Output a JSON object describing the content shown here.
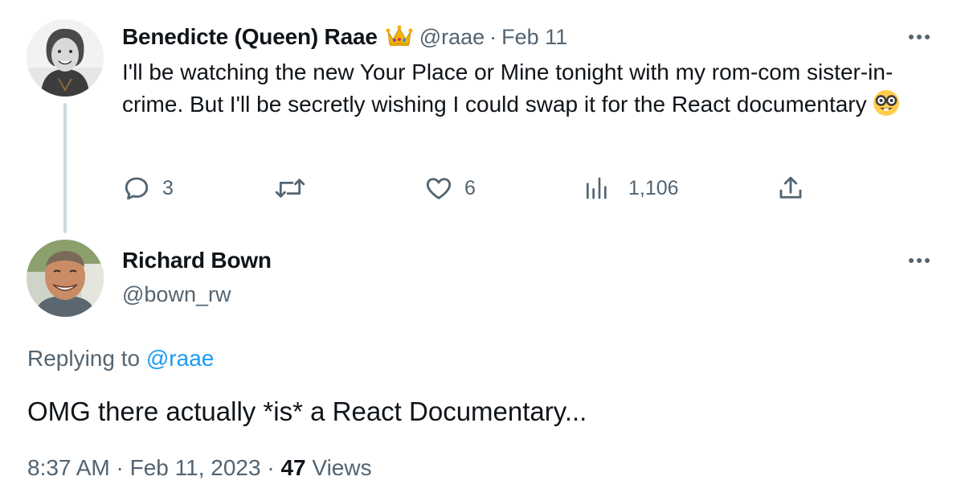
{
  "tweet1": {
    "author_name": "Benedicte (Queen) Raae",
    "author_badge": "crown-emoji",
    "handle": "@raae",
    "separator": "·",
    "date": "Feb 11",
    "text": "I'll be watching the new Your Place or Mine tonight with my rom-com sister-in-crime. But I'll be secretly wishing I could swap it for the React documentary",
    "text_emoji": "nerd-face-emoji",
    "actions": {
      "replies": "3",
      "retweets": "",
      "likes": "6",
      "views": "1,106"
    }
  },
  "tweet2": {
    "author_name": "Richard Bown",
    "handle": "@bown_rw",
    "replying_prefix": "Replying to",
    "replying_handle": "@raae",
    "text": "OMG there actually *is* a React Documentary...",
    "time": "8:37 AM",
    "separator": "·",
    "date": "Feb 11, 2023",
    "views_count": "47",
    "views_label": "Views"
  },
  "colors": {
    "text": "#0f1419",
    "muted": "#536471",
    "link": "#1d9bf0",
    "thread_line": "#cfd9de"
  }
}
